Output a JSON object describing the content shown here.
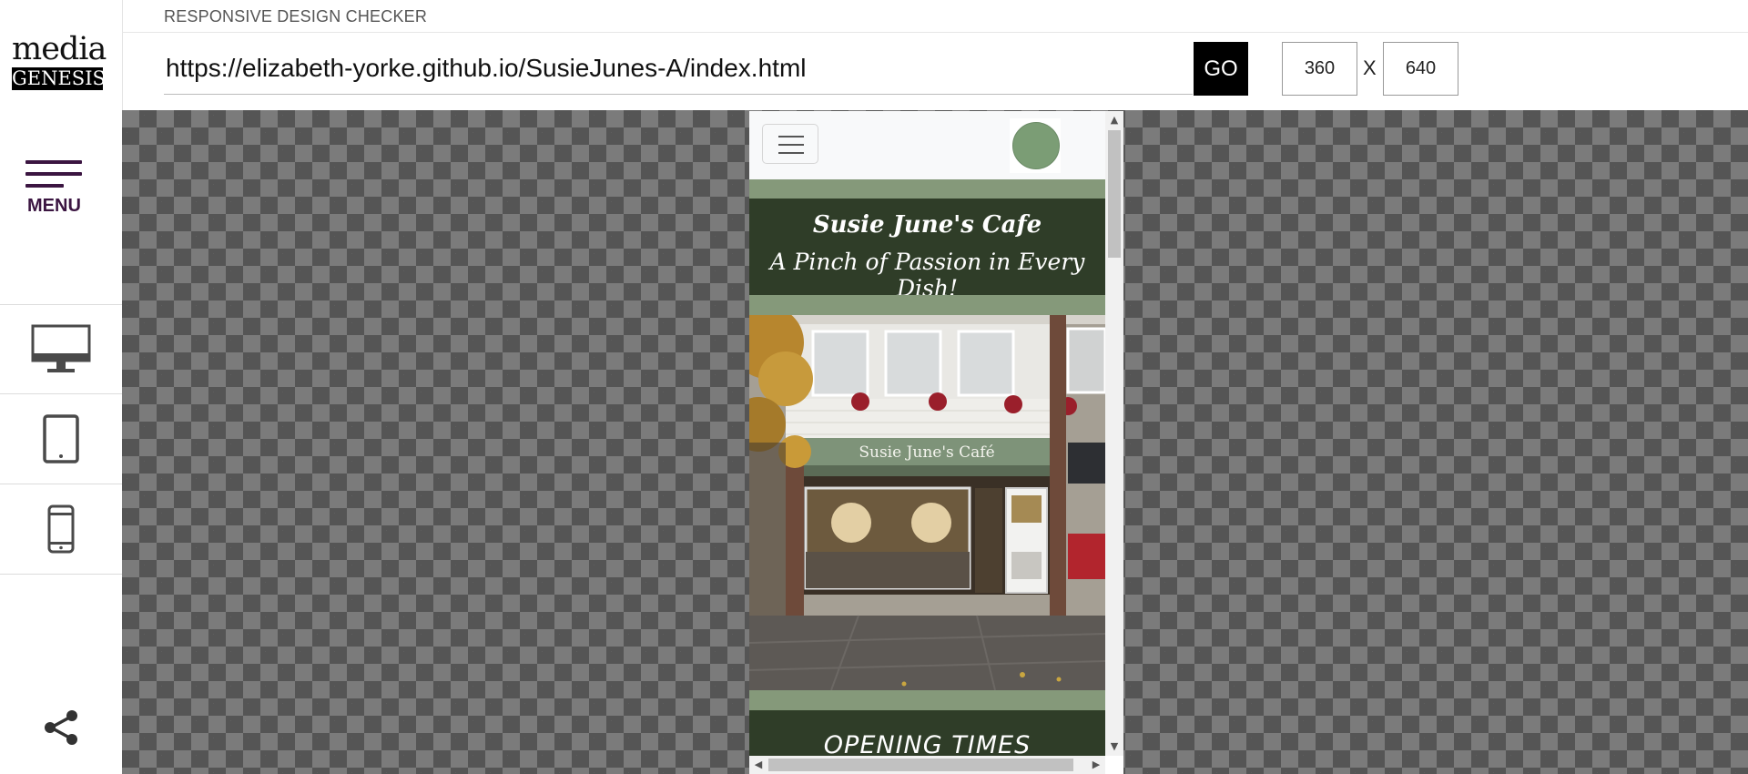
{
  "app": {
    "title": "RESPONSIVE DESIGN CHECKER",
    "logo_top": "media",
    "logo_bottom": "GENESIS"
  },
  "sidebar": {
    "menu_label": "MENU",
    "devices": [
      {
        "name": "desktop",
        "icon": "desktop-monitor-icon"
      },
      {
        "name": "tablet",
        "icon": "tablet-icon"
      },
      {
        "name": "mobile",
        "icon": "mobile-phone-icon"
      }
    ],
    "share_icon": "share-icon"
  },
  "toolbar": {
    "url_value": "https://elizabeth-yorke.github.io/SusieJunes-A/index.html",
    "go_label": "GO",
    "width_value": "360",
    "separator": "X",
    "height_value": "640"
  },
  "preview": {
    "site_title": "Susie June's Cafe",
    "site_tagline": "A Pinch of Passion in Every Dish!",
    "section_heading": "OPENING TIMES",
    "photo_sign": "Susie June's Café",
    "colors": {
      "band_light": "#85997a",
      "band_dark": "#2f3d28",
      "logo_green": "#7b9d75"
    }
  },
  "colors": {
    "brand_purple": "#3b1541",
    "checker_dark": "#555555",
    "checker_light": "#7b7b7b"
  }
}
